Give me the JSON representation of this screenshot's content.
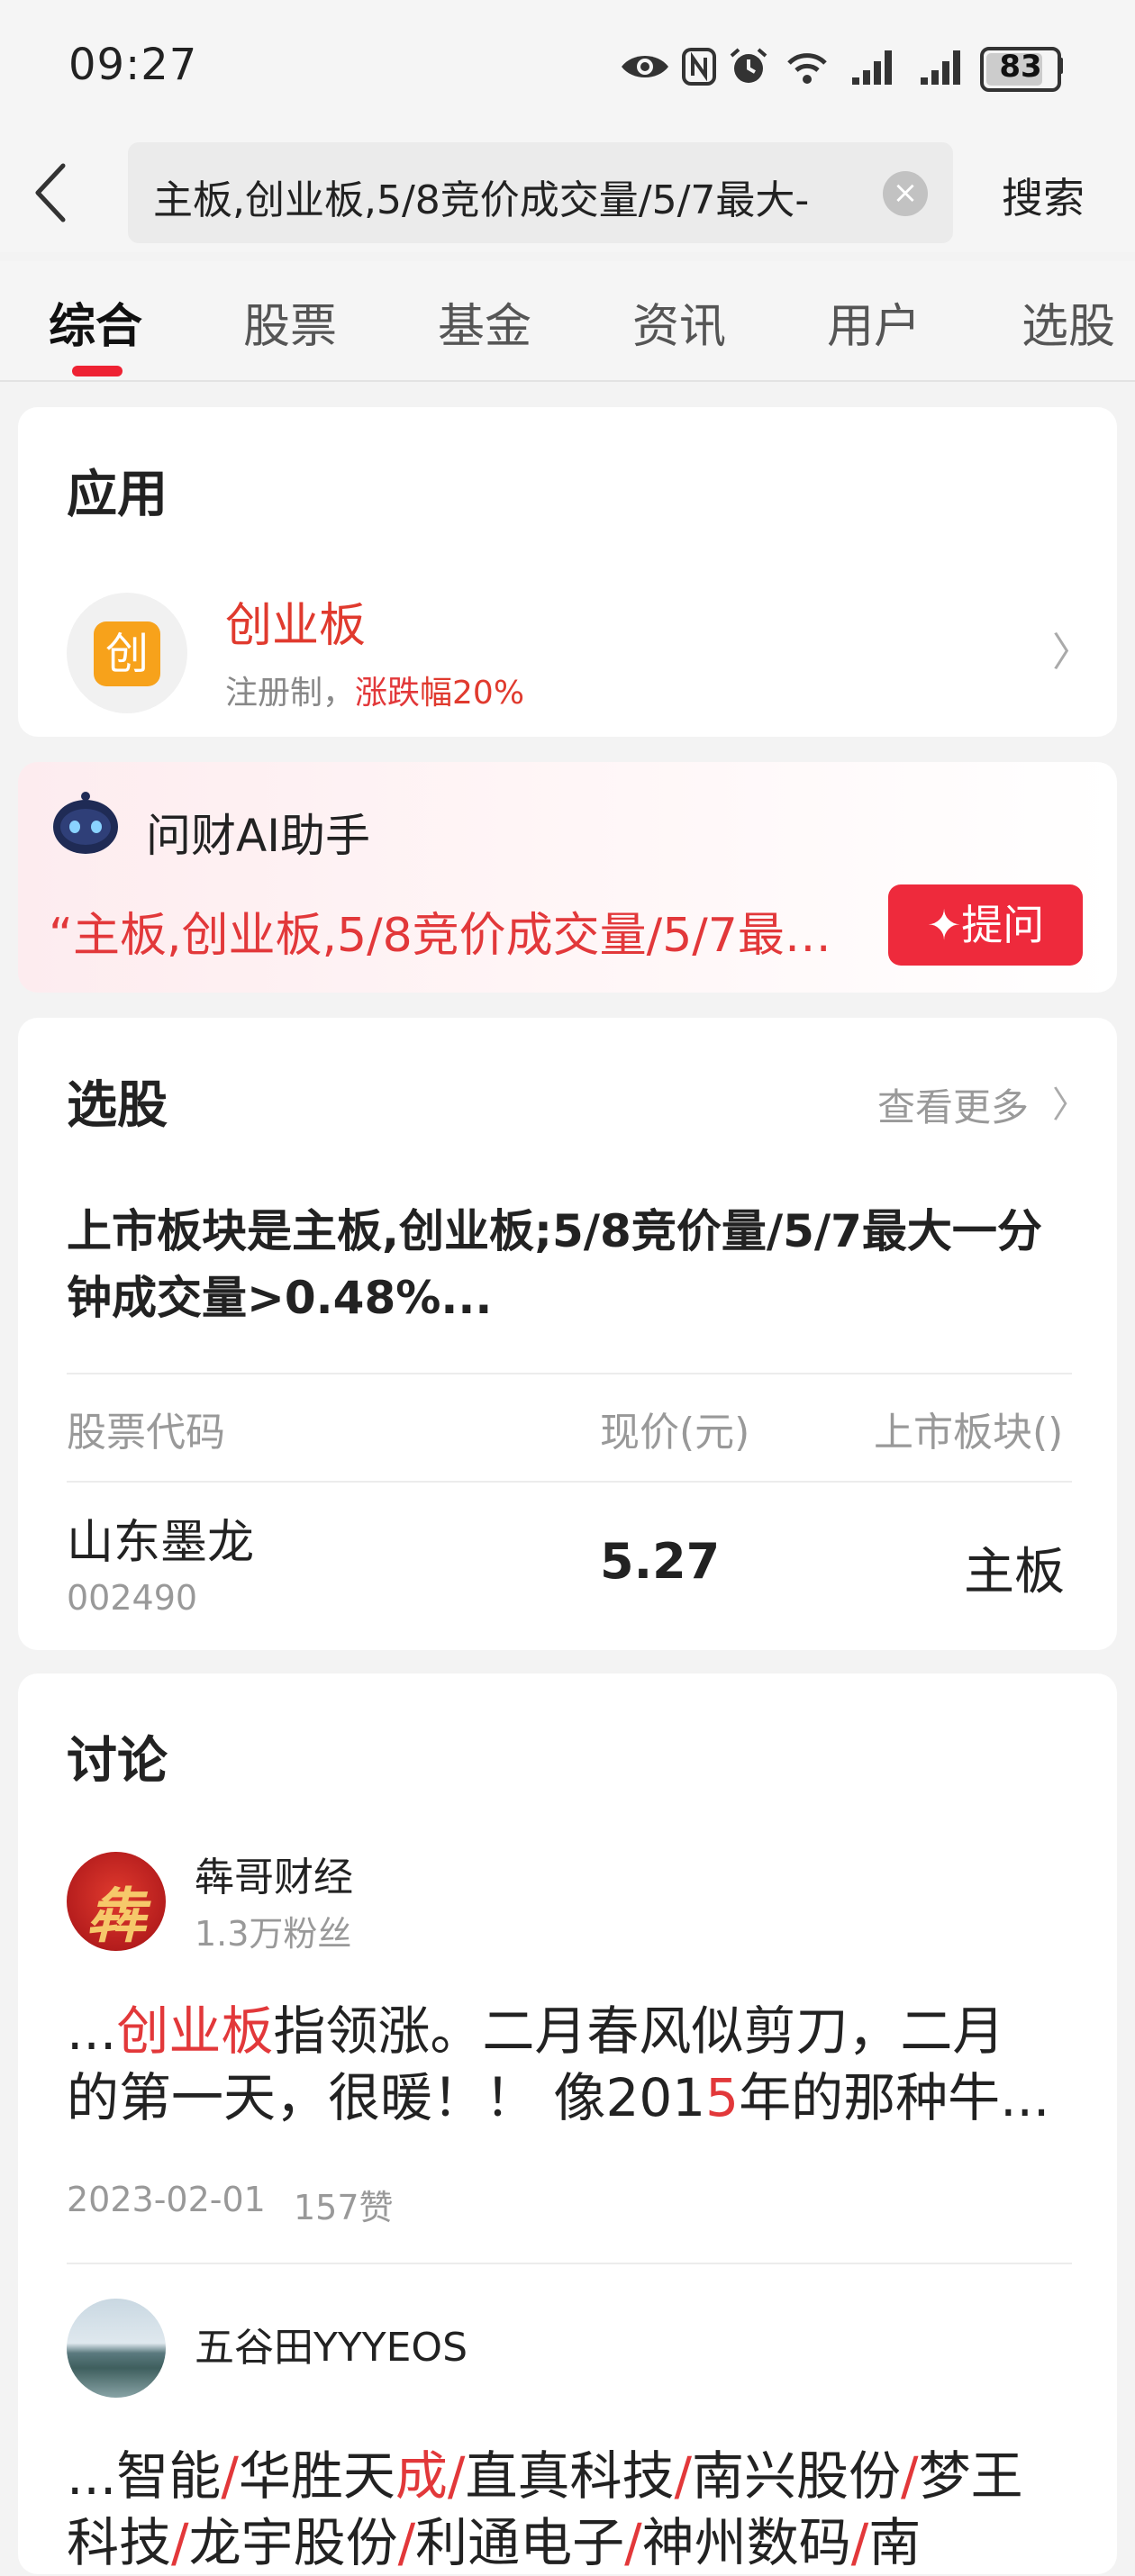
{
  "status_bar": {
    "time": "09:27",
    "battery": "83"
  },
  "search": {
    "query": "主板,创业板,5/8竞价成交量/5/7最大-",
    "button": "搜索"
  },
  "tabs": [
    "综合",
    "股票",
    "基金",
    "资讯",
    "用户",
    "选股"
  ],
  "app_section": {
    "title": "应用",
    "app": {
      "icon_glyph": "创",
      "name": "创业板",
      "desc_prefix": "注册制，",
      "desc_highlight_1": "涨跌",
      "desc_highlight_2": "幅20%"
    }
  },
  "ai_assistant": {
    "title": "问财AI助手",
    "quote": "“主板,创业板,5/8竞价成交量/5/7最…",
    "ask_button": "✦提问"
  },
  "stock_select": {
    "title": "选股",
    "more": "查看更多",
    "criteria": "上市板块是主板,创业板;5/8竞价量/5/7最大一分钟成交量>0.48%...",
    "columns": [
      "股票代码",
      "现价(元)",
      "上市板块()"
    ],
    "rows": [
      {
        "name": "山东墨龙",
        "code": "002490",
        "price": "5.27",
        "board": "主板"
      }
    ]
  },
  "discussion": {
    "title": "讨论",
    "posts": [
      {
        "author": "犇哥财经",
        "fans": "1.3万粉丝",
        "avatar_glyph": "犇",
        "t1": "...",
        "t2": "创业板",
        "t3": "指领涨。二月春风似剪刀，二月",
        "t4": "的第一天，很暖！！ 像201",
        "t5": "5",
        "t6": "年的那种牛...",
        "date": "2023-02-01",
        "likes": "157赞"
      },
      {
        "author": "五谷田YYYEOS",
        "line1": [
          "...智能",
          "/",
          "华胜天",
          "成",
          "/",
          "直真科技",
          "/",
          "南兴股份",
          "/",
          "梦王"
        ],
        "line2": [
          "科技",
          "/",
          "龙宇股份",
          "/",
          "利通电子",
          "/",
          "神州数码",
          "/",
          "南"
        ]
      }
    ]
  },
  "colors": {
    "accent_red": "#EE2A3C",
    "text_red": "#E2383A",
    "app_orange": "#F7A21B"
  }
}
